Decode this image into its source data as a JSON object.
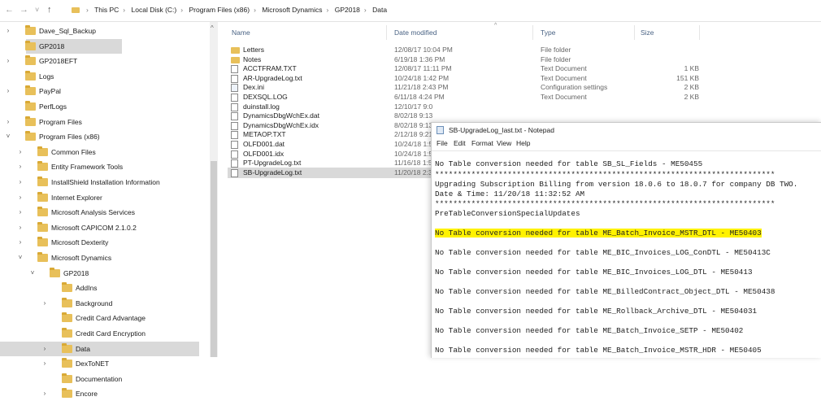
{
  "address_bar": {
    "back_glyph": "←",
    "forward_glyph": "→",
    "recent_glyph": "˅",
    "up_glyph": "↑",
    "path": [
      "This PC",
      "Local Disk (C:)",
      "Program Files (x86)",
      "Microsoft Dynamics",
      "GP2018",
      "Data"
    ],
    "separator": "›"
  },
  "nav_pane": {
    "items": [
      {
        "label": "Dave_Sql_Backup",
        "chevron": "›",
        "selected": false
      },
      {
        "label": "GP2018",
        "chevron": "",
        "selected": true
      },
      {
        "label": "GP2018EFT",
        "chevron": "›",
        "selected": false
      },
      {
        "label": "Logs",
        "chevron": "",
        "selected": false
      },
      {
        "label": "PayPal",
        "chevron": "›",
        "selected": false
      },
      {
        "label": "PerfLogs",
        "chevron": "",
        "selected": false
      },
      {
        "label": "Program Files",
        "chevron": "›",
        "selected": false
      },
      {
        "label": "Program Files (x86)",
        "chevron": "˅",
        "selected": false
      },
      {
        "label": "Common Files",
        "chevron": "›",
        "selected": false
      },
      {
        "label": "Entity Framework Tools",
        "chevron": "›",
        "selected": false
      },
      {
        "label": "InstallShield Installation Information",
        "chevron": "›",
        "selected": false
      },
      {
        "label": "Internet Explorer",
        "chevron": "›",
        "selected": false
      },
      {
        "label": "Microsoft Analysis Services",
        "chevron": "›",
        "selected": false
      },
      {
        "label": "Microsoft CAPICOM 2.1.0.2",
        "chevron": "›",
        "selected": false
      },
      {
        "label": "Microsoft Dexterity",
        "chevron": "›",
        "selected": false
      },
      {
        "label": "Microsoft Dynamics",
        "chevron": "˅",
        "selected": false
      },
      {
        "label": "GP2018",
        "chevron": "˅",
        "selected": false
      },
      {
        "label": "AddIns",
        "chevron": "",
        "selected": false
      },
      {
        "label": "Background",
        "chevron": "›",
        "selected": false
      },
      {
        "label": "Credit Card Advantage",
        "chevron": "",
        "selected": false
      },
      {
        "label": "Credit Card Encryption",
        "chevron": "",
        "selected": false
      },
      {
        "label": "Data",
        "chevron": "›",
        "selected": true
      },
      {
        "label": "DexToNET",
        "chevron": "›",
        "selected": false
      },
      {
        "label": "Documentation",
        "chevron": "",
        "selected": false
      },
      {
        "label": "Encore",
        "chevron": "›",
        "selected": false
      }
    ],
    "scroll_up_glyph": "^"
  },
  "file_list": {
    "sort_glyph": "^",
    "columns": {
      "name": "Name",
      "date": "Date modified",
      "type": "Type",
      "size": "Size"
    },
    "rows": [
      {
        "icon": "folder",
        "name": "Letters",
        "date": "12/08/17 10:04 PM",
        "type": "File folder",
        "size": "",
        "selected": false
      },
      {
        "icon": "folder",
        "name": "Notes",
        "date": "6/19/18 1:36 PM",
        "type": "File folder",
        "size": "",
        "selected": false
      },
      {
        "icon": "doc",
        "name": "ACCTFRAM.TXT",
        "date": "12/08/17 11:11 PM",
        "type": "Text Document",
        "size": "1 KB",
        "selected": false
      },
      {
        "icon": "doc",
        "name": "AR-UpgradeLog.txt",
        "date": "10/24/18 1:42 PM",
        "type": "Text Document",
        "size": "151 KB",
        "selected": false
      },
      {
        "icon": "ini",
        "name": "Dex.ini",
        "date": "11/21/18 2:43 PM",
        "type": "Configuration settings",
        "size": "2 KB",
        "selected": false
      },
      {
        "icon": "doc",
        "name": "DEXSQL.LOG",
        "date": "6/11/18 4:24 PM",
        "type": "Text Document",
        "size": "2 KB",
        "selected": false
      },
      {
        "icon": "doc",
        "name": "duinstall.log",
        "date": "12/10/17 9:0",
        "type": "",
        "size": "",
        "selected": false
      },
      {
        "icon": "doc",
        "name": "DynamicsDbgWchEx.dat",
        "date": "8/02/18 9:13",
        "type": "",
        "size": "",
        "selected": false
      },
      {
        "icon": "doc",
        "name": "DynamicsDbgWchEx.idx",
        "date": "8/02/18 9:13",
        "type": "",
        "size": "",
        "selected": false
      },
      {
        "icon": "doc",
        "name": "METAOP.TXT",
        "date": "2/12/18 9:21",
        "type": "",
        "size": "",
        "selected": false
      },
      {
        "icon": "doc",
        "name": "OLFD001.dat",
        "date": "10/24/18 1:5",
        "type": "",
        "size": "",
        "selected": false
      },
      {
        "icon": "doc",
        "name": "OLFD001.idx",
        "date": "10/24/18 1:5",
        "type": "",
        "size": "",
        "selected": false
      },
      {
        "icon": "doc",
        "name": "PT-UpgradeLog.txt",
        "date": "11/16/18 1:5",
        "type": "",
        "size": "",
        "selected": false
      },
      {
        "icon": "doc",
        "name": "SB-UpgradeLog.txt",
        "date": "11/20/18 2:3",
        "type": "",
        "size": "",
        "selected": true
      }
    ]
  },
  "notepad": {
    "title": "SB-UpgradeLog_last.txt - Notepad",
    "menu": [
      "File",
      "Edit",
      "Format",
      "View",
      "Help"
    ],
    "highlight_color": "#fff200",
    "lines": [
      {
        "text": "No Table conversion needed for table SB_SL_Fields - ME50455",
        "highlight": false
      },
      {
        "text": "***************************************************************************",
        "highlight": false
      },
      {
        "text": "Upgrading Subscription Billing from version 18.0.6 to 18.0.7 for company DB TWO.",
        "highlight": false
      },
      {
        "text": "Date & Time: 11/20/18 11:32:52 AM",
        "highlight": false
      },
      {
        "text": "***************************************************************************",
        "highlight": false
      },
      {
        "text": "PreTableConversionSpecialUpdates",
        "highlight": false
      },
      {
        "text": "No Table conversion needed for table ME_Batch_Invoice_MSTR_DTL - ME50403",
        "highlight": true
      },
      {
        "text": "No Table conversion needed for table ME_BIC_Invoices_LOG_ConDTL - ME50413C",
        "highlight": false
      },
      {
        "text": "No Table conversion needed for table ME_BIC_Invoices_LOG_DTL - ME50413",
        "highlight": false
      },
      {
        "text": "No Table conversion needed for table ME_BilledContract_Object_DTL - ME50438",
        "highlight": false
      },
      {
        "text": "No Table conversion needed for table ME_Rollback_Archive_DTL - ME504031",
        "highlight": false
      },
      {
        "text": "No Table conversion needed for table ME_Batch_Invoice_SETP - ME50402",
        "highlight": false
      },
      {
        "text": "No Table conversion needed for table ME_Batch_Invoice_MSTR_HDR - ME50405",
        "highlight": false
      }
    ]
  }
}
